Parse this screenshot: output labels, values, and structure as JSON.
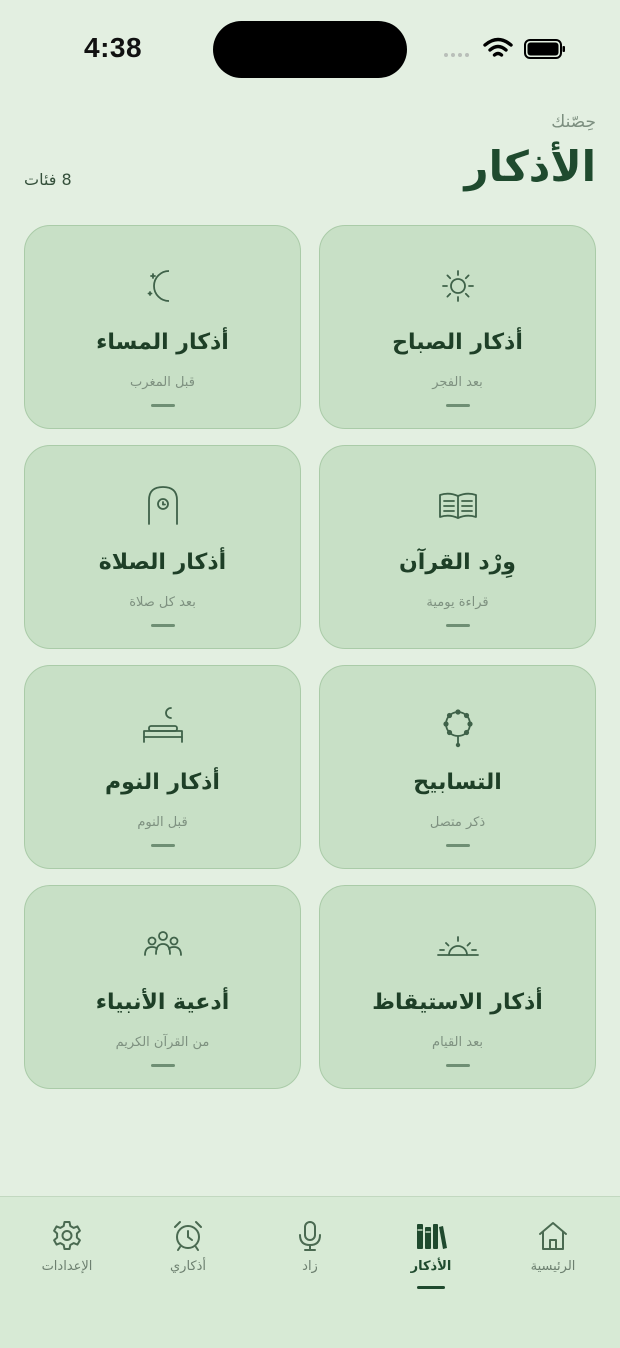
{
  "status": {
    "time": "4:38"
  },
  "header": {
    "subtitle": "حِصّنك",
    "title": "الأذكار",
    "count": "8 فئات"
  },
  "categories": [
    {
      "title": "أذكار الصباح",
      "description": "بعد الفجر",
      "icon": "sun-icon"
    },
    {
      "title": "أذكار المساء",
      "description": "قبل المغرب",
      "icon": "moon-stars-icon"
    },
    {
      "title": "وِرْد القرآن",
      "description": "قراءة يومية",
      "icon": "open-book-icon"
    },
    {
      "title": "أذكار الصلاة",
      "description": "بعد كل صلاة",
      "icon": "mihrab-clock-icon"
    },
    {
      "title": "التسابيح",
      "description": "ذكر متصل",
      "icon": "prayer-beads-icon"
    },
    {
      "title": "أذكار النوم",
      "description": "قبل النوم",
      "icon": "bed-moon-icon"
    },
    {
      "title": "أذكار الاستيقاظ",
      "description": "بعد القيام",
      "icon": "sunrise-icon"
    },
    {
      "title": "أدعية الأنبياء",
      "description": "من القرآن الكريم",
      "icon": "people-group-icon"
    }
  ],
  "tabs": [
    {
      "label": "الرئيسية",
      "icon": "home-icon"
    },
    {
      "label": "الأذكار",
      "icon": "books-icon",
      "active": true
    },
    {
      "label": "زاد",
      "icon": "microphone-icon"
    },
    {
      "label": "أذكاري",
      "icon": "alarm-clock-icon"
    },
    {
      "label": "الإعدادات",
      "icon": "gear-icon"
    }
  ],
  "colors": {
    "background": "#e3efe1",
    "card": "#c8e0c6",
    "accent": "#1f4a2e"
  }
}
